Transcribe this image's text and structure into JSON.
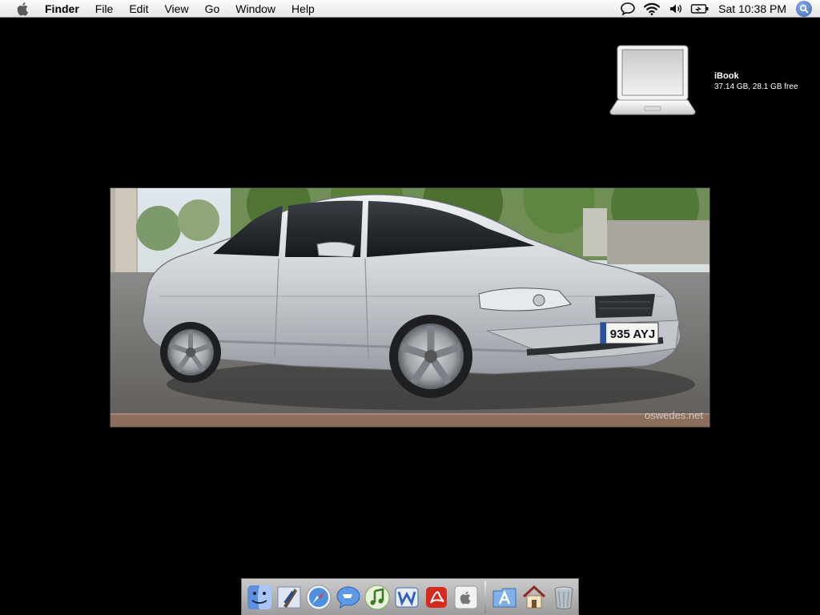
{
  "menubar": {
    "app": "Finder",
    "items": [
      "File",
      "Edit",
      "View",
      "Go",
      "Window",
      "Help"
    ],
    "clock": "Sat 10:38 PM"
  },
  "desktop": {
    "drive": {
      "name": "iBook",
      "detail": "37.14 GB, 28.1 GB free"
    }
  },
  "photo": {
    "plate": "935 AYJ",
    "watermark": "oswedes.net"
  },
  "dock": {
    "apps": [
      "finder-icon",
      "mail-icon",
      "safari-icon",
      "ichat-icon",
      "itunes-icon",
      "word-icon",
      "acrobat-icon",
      "apple-icon"
    ],
    "right": [
      "applications-folder-icon",
      "home-folder-icon",
      "trash-icon"
    ]
  }
}
